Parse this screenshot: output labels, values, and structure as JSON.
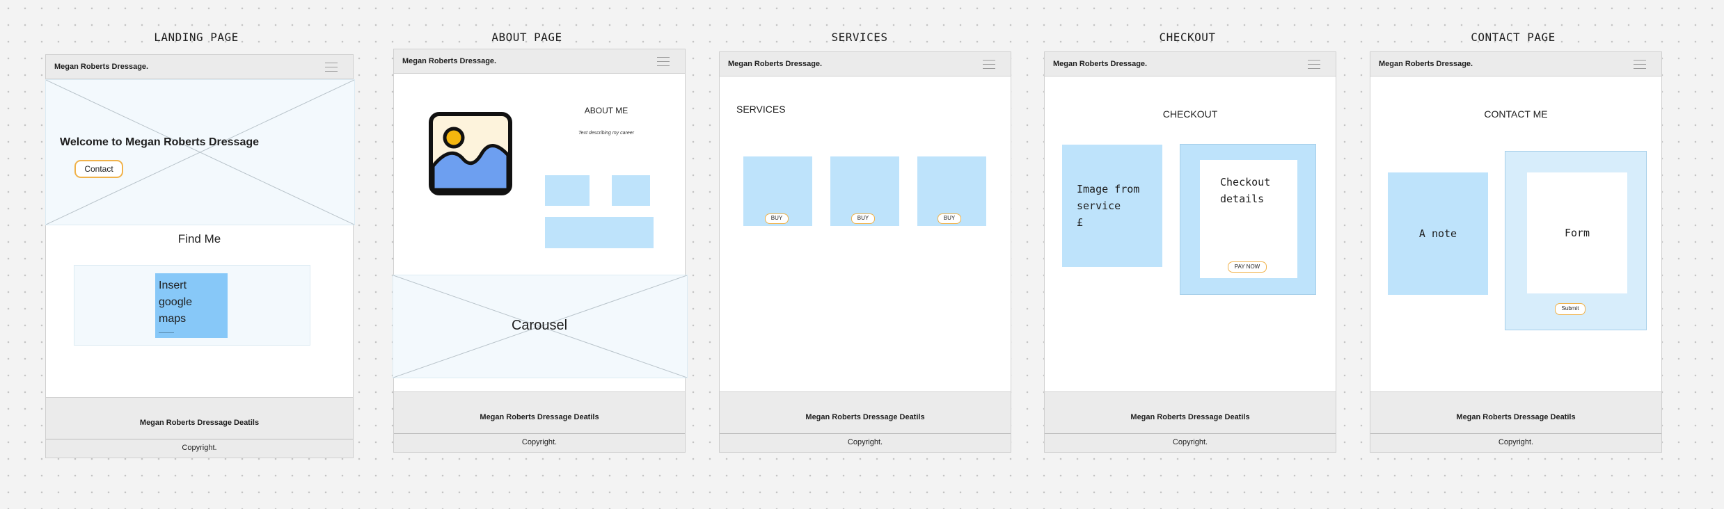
{
  "brand": "Megan Roberts Dressage.",
  "footer_title": "Megan Roberts Dressage Deatils",
  "copyright": "Copyright.",
  "pages": {
    "landing": {
      "title": "LANDING PAGE",
      "hero_heading": "Welcome to Megan Roberts Dressage",
      "contact_button": "Contact",
      "find_me": "Find Me",
      "map_note_lines": [
        "Insert",
        "google",
        "maps"
      ]
    },
    "about": {
      "title": "ABOUT PAGE",
      "heading": "ABOUT ME",
      "caption": "Text describing my career",
      "carousel": "Carousel",
      "image_icon": "image-icon"
    },
    "services": {
      "title": "SERVICES",
      "heading": "SERVICES",
      "buy_labels": [
        "BUY",
        "BUY",
        "BUY"
      ]
    },
    "checkout": {
      "title": "CHECKOUT",
      "heading": "CHECKOUT",
      "image_note_lines": [
        "Image from",
        "service",
        "£"
      ],
      "details_lines": [
        "Checkout",
        "details"
      ],
      "pay_button": "PAY NOW"
    },
    "contact": {
      "title": "CONTACT PAGE",
      "heading": "CONTACT ME",
      "note": "A note",
      "form": "Form",
      "submit": "Submit"
    }
  },
  "colors": {
    "canvas": "#f3f3f3",
    "bar": "#ebebeb",
    "block": "#bee3fb",
    "sticky": "#87c8f8",
    "button_border": "#f0b24a",
    "form_panel": "#d7edfb"
  }
}
